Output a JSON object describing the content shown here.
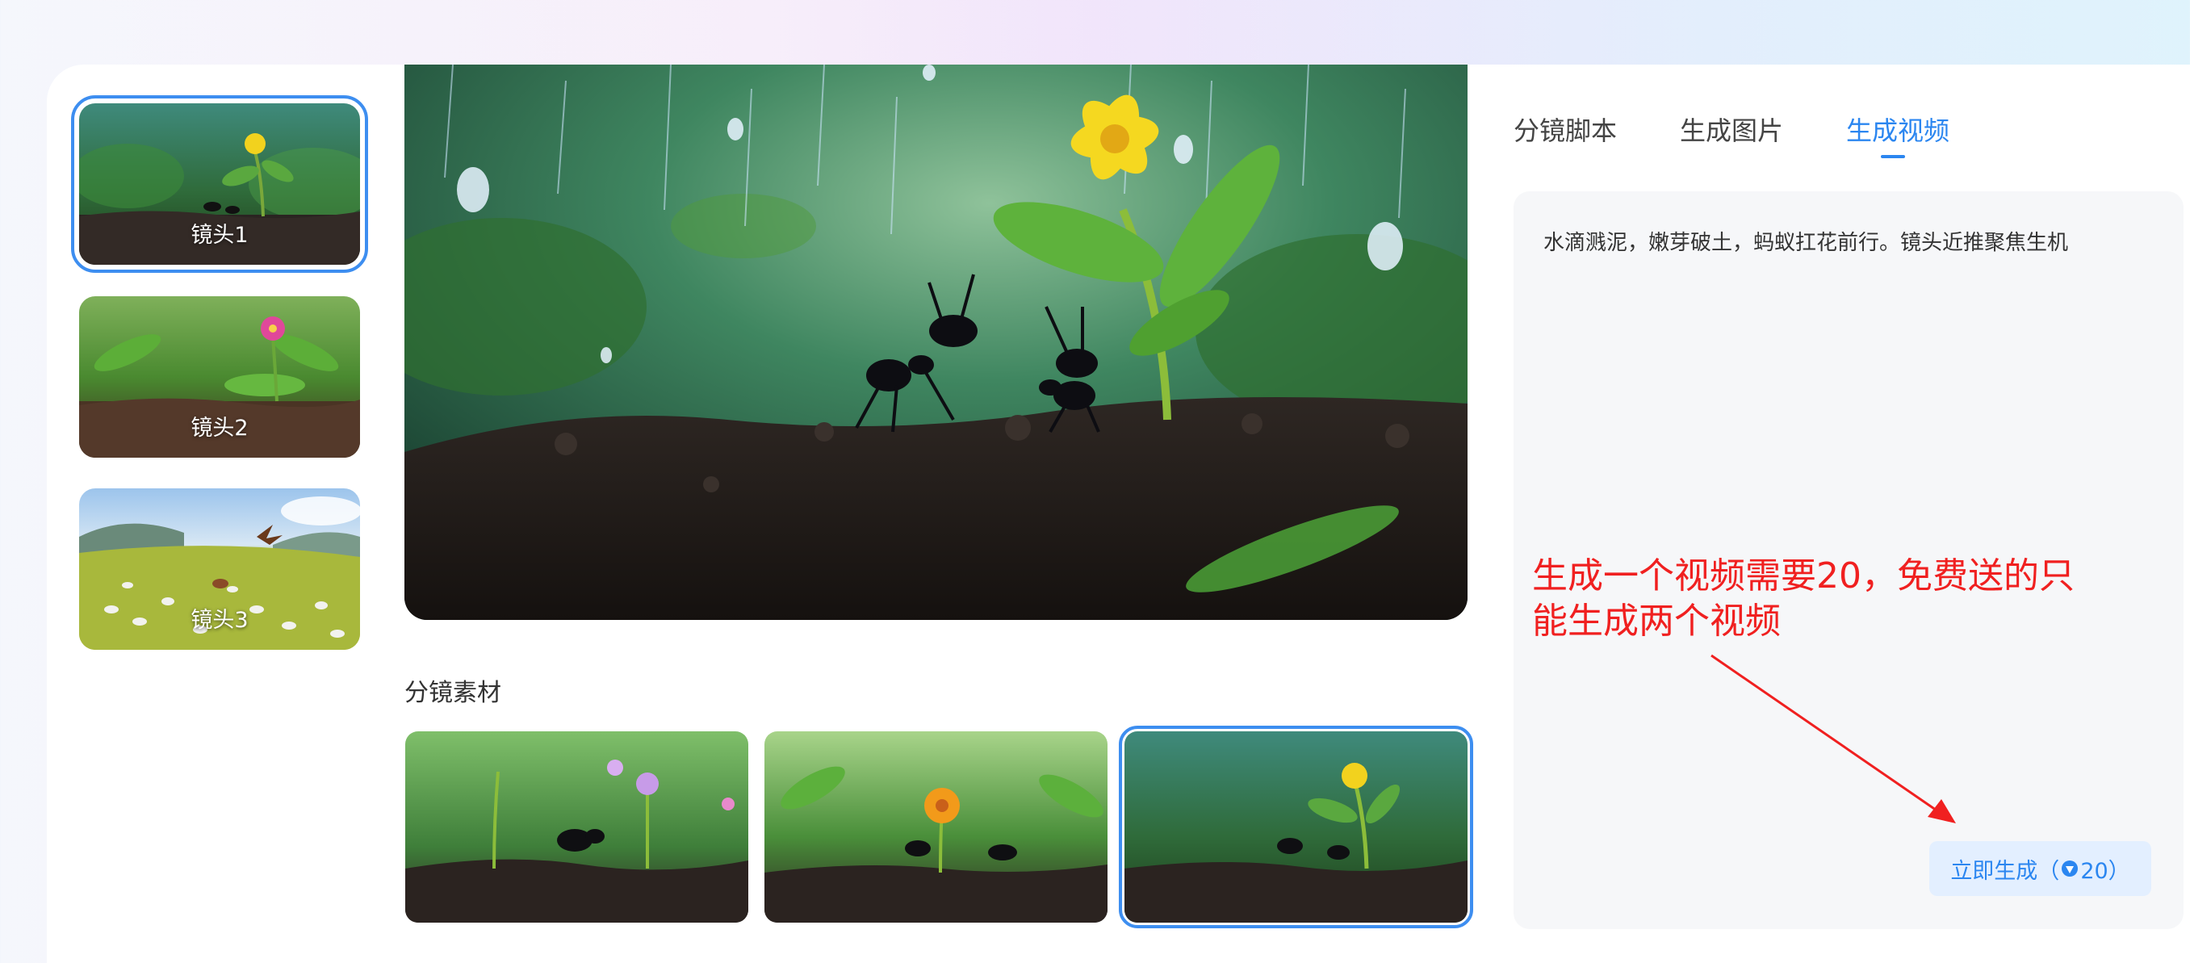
{
  "shots": [
    {
      "label": "镜头1",
      "selected": true
    },
    {
      "label": "镜头2",
      "selected": false
    },
    {
      "label": "镜头3",
      "selected": false
    }
  ],
  "tabs": [
    {
      "label": "分镜脚本",
      "active": false
    },
    {
      "label": "生成图片",
      "active": false
    },
    {
      "label": "生成视频",
      "active": true
    }
  ],
  "materials": {
    "title": "分镜素材",
    "selected_index": 2
  },
  "prompt": {
    "text": "水滴溅泥，嫩芽破土，蚂蚁扛花前行。镜头近推聚焦生机"
  },
  "annotation": {
    "line1": "生成一个视频需要20，免费送的只",
    "line2": "能生成两个视频"
  },
  "generate_button": {
    "label": "立即生成（",
    "cost": "20）",
    "icon": "coin-icon"
  },
  "colors": {
    "accent": "#2b86f0",
    "annotation": "#f02020"
  }
}
